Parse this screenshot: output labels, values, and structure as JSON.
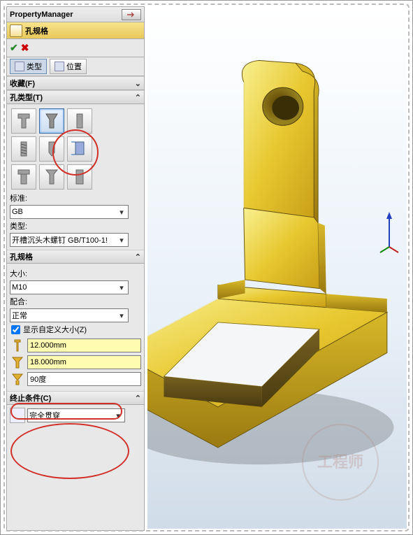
{
  "pm": {
    "title": "PropertyManager"
  },
  "feature": {
    "title": "孔规格"
  },
  "tabs": {
    "type": "类型",
    "position": "位置"
  },
  "sections": {
    "favorites": "收藏(F)",
    "holeType": "孔类型(T)",
    "holeSpec": "孔规格",
    "endCond": "终止条件(C)"
  },
  "holeType": {
    "standardLabel": "标准:",
    "standardValue": "GB",
    "typeLabel": "类型:",
    "typeValue": "开槽沉头木螺钉 GB/T100-1!"
  },
  "holeSpec": {
    "sizeLabel": "大小:",
    "sizeValue": "M10",
    "fitLabel": "配合:",
    "fitValue": "正常",
    "customChk": "显示自定义大小(Z)",
    "dim1": "12.000mm",
    "dim2": "18.000mm",
    "dim3": "90度"
  },
  "endCond": {
    "value": "完全贯穿"
  },
  "watermark": "工程师"
}
